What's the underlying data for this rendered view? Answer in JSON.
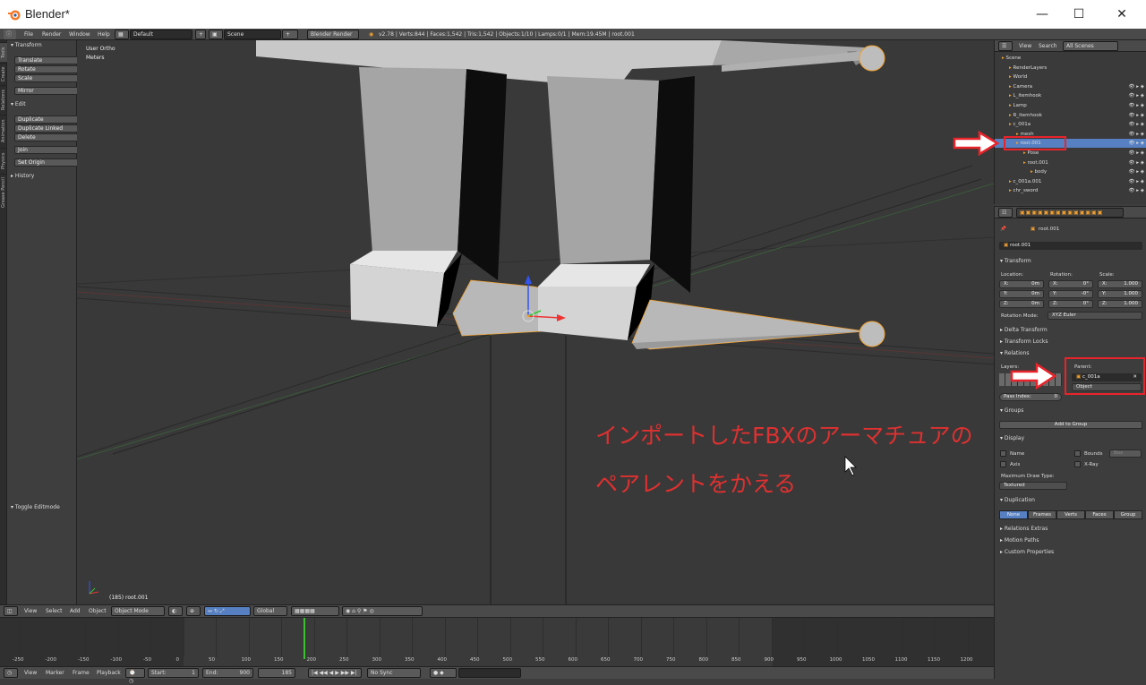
{
  "window": {
    "title": "Blender*",
    "minimize": "—",
    "maximize": "☐",
    "close": "✕"
  },
  "info_header": {
    "menus": [
      "File",
      "Render",
      "Window",
      "Help"
    ],
    "layout": "Default",
    "scene": "Scene",
    "engine": "Blender Render",
    "stats": "v2.78 | Verts:844 | Faces:1,542 | Tris:1,542 | Objects:1/10 | Lamps:0/1 | Mem:19.45M | root.001"
  },
  "left_tabs": [
    "Tools",
    "Create",
    "Relations",
    "Animation",
    "Physics",
    "Grease Pencil"
  ],
  "tool_shelf": {
    "transform_header": "Transform",
    "transform_buttons": [
      "Translate",
      "Rotate",
      "Scale",
      "Mirror"
    ],
    "edit_header": "Edit",
    "edit_buttons": [
      "Duplicate",
      "Duplicate Linked",
      "Delete",
      "Join",
      "Set Origin"
    ],
    "history_header": "History",
    "toggle_editmode": "Toggle Editmode"
  },
  "viewport": {
    "view_label": "User Ortho",
    "units_label": "Meters",
    "object_label": "(185) root.001"
  },
  "view3d_header": {
    "menus": [
      "View",
      "Select",
      "Add",
      "Object"
    ],
    "mode": "Object Mode",
    "orientation": "Global"
  },
  "timeline": {
    "ticks": [
      "-250",
      "-200",
      "-150",
      "-100",
      "-50",
      "0",
      "50",
      "100",
      "150",
      "200",
      "250",
      "300",
      "350",
      "400",
      "450",
      "500",
      "550",
      "600",
      "650",
      "700",
      "750",
      "800",
      "850",
      "900",
      "950",
      "1000",
      "1050",
      "1100",
      "1150",
      "1200"
    ],
    "current_frame": 185,
    "menus": [
      "View",
      "Marker",
      "Frame",
      "Playback"
    ],
    "start_label": "Start:",
    "start_value": "1",
    "end_label": "End:",
    "end_value": "900",
    "current_value": "185",
    "sync": "No Sync"
  },
  "outliner": {
    "header": {
      "view": "View",
      "search": "Search",
      "filter": "All Scenes"
    },
    "rows": [
      "Scene",
      "RenderLayers",
      "World",
      "Camera",
      "L_itemhook",
      "Lamp",
      "R_itemhook",
      "c_001a",
      "mesh",
      "root.001",
      "Pose",
      "root.001",
      "body",
      "c_001a.001",
      "chr_sword"
    ]
  },
  "properties": {
    "breadcrumb": "root.001",
    "object_name": "root.001",
    "transform": {
      "header": "Transform",
      "location_label": "Location:",
      "rotation_label": "Rotation:",
      "scale_label": "Scale:",
      "location": [
        {
          "axis": "X:",
          "value": "0m"
        },
        {
          "axis": "Y:",
          "value": "0m"
        },
        {
          "axis": "Z:",
          "value": "0m"
        }
      ],
      "rotation": [
        {
          "axis": "X:",
          "value": "0°"
        },
        {
          "axis": "Y:",
          "value": "-0°"
        },
        {
          "axis": "Z:",
          "value": "0°"
        }
      ],
      "scale": [
        {
          "axis": "X:",
          "value": "1.000"
        },
        {
          "axis": "Y:",
          "value": "1.000"
        },
        {
          "axis": "Z:",
          "value": "1.000"
        }
      ],
      "rotation_mode_label": "Rotation Mode:",
      "rotation_mode": "XYZ Euler"
    },
    "delta_transform": "Delta Transform",
    "transform_locks": "Transform Locks",
    "relations": {
      "header": "Relations",
      "layers_label": "Layers:",
      "parent_label": "Parent:",
      "parent_value": "c_001a",
      "parent_type": "Object",
      "pass_index_label": "Pass Index:",
      "pass_index": "0"
    },
    "groups": {
      "header": "Groups",
      "add_button": "Add to Group"
    },
    "display": {
      "header": "Display",
      "name": "Name",
      "axis": "Axis",
      "bounds": "Bounds",
      "xray": "X-Ray",
      "bounds_type": "Box",
      "max_draw_label": "Maximum Draw Type:",
      "max_draw": "Textured"
    },
    "duplication": {
      "header": "Duplication",
      "options": [
        "None",
        "Frames",
        "Verts",
        "Faces",
        "Group"
      ],
      "selected": "None"
    },
    "relations_extras": "Relations Extras",
    "motion_paths": "Motion Paths",
    "custom_properties": "Custom Properties"
  },
  "annotation": {
    "line1": "インポートしたFBXのアーマチュアの",
    "line2": "ペアレントをかえる",
    "color": "#e03030"
  },
  "colors": {
    "highlight_red": "#e8242a",
    "selected_blue": "#5680c2",
    "object_orange": "#f0a030"
  }
}
